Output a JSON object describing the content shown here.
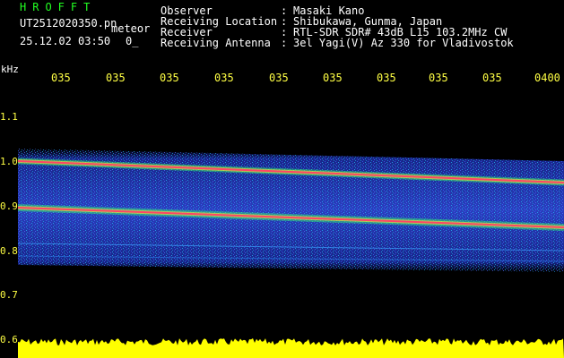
{
  "header": {
    "app_title": "HROFFT",
    "file_name": "UT2512020350.pn",
    "meteor_label": "meteor",
    "datetime": "25.12.02 03:50",
    "count": "0_"
  },
  "meta": [
    {
      "key": "Observer",
      "value": "Masaki Kano"
    },
    {
      "key": "Receiving Location",
      "value": "Shibukawa, Gunma, Japan"
    },
    {
      "key": "Receiver",
      "value": "RTL-SDR SDR# 43dB L15 103.2MHz CW"
    },
    {
      "key": "Receiving Antenna",
      "value": "3el Yagi(V) Az 330 for Vladivostok"
    }
  ],
  "separator": ":",
  "axis": {
    "y_unit": "kHz",
    "x_ticks": [
      "035",
      "035",
      "035",
      "035",
      "035",
      "035",
      "035",
      "035",
      "035",
      "0400"
    ],
    "y_ticks": [
      "1.1",
      "1.0",
      "0.9",
      "0.8",
      "0.7",
      "0.6"
    ]
  },
  "colors": {
    "title": "#22ff22",
    "tick": "#ffff44",
    "signal_line": "#ff4466",
    "noise_base": "#1a2a9a",
    "bottom_bar": "#ffff00"
  }
}
